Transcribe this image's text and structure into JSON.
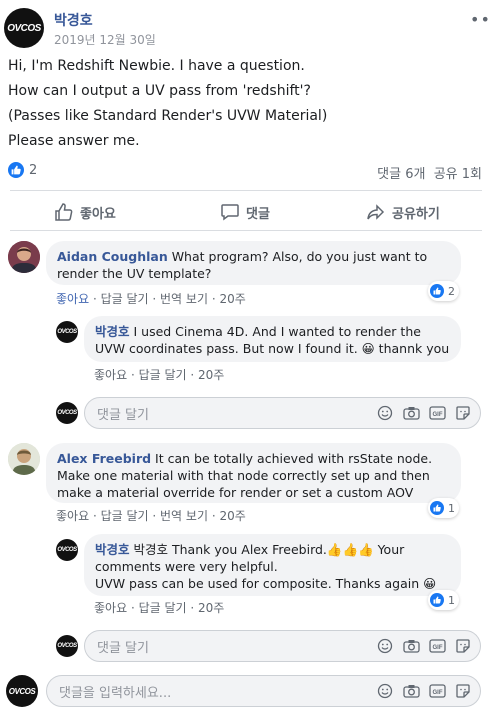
{
  "post": {
    "author": "박경호",
    "date": "2019년 12월 30일",
    "lines": [
      "Hi, I'm Redshift Newbie. I have a question.",
      "How can I output a UV pass from 'redshift'?",
      "(Passes like Standard Render's UVW Material)",
      "Please answer me."
    ],
    "reaction_count": "2",
    "stats": "댓글 6개  공유 1회",
    "more_icon": "ellipsis-icon",
    "avatar_text": "OVCOS"
  },
  "actions": {
    "like": "좋아요",
    "comment": "댓글",
    "share": "공유하기"
  },
  "comments": [
    {
      "author": "Aidan Coughlan",
      "text": " What program? Also, do you just want to render the UV template?",
      "like": "좋아요",
      "reply": "답글 달기",
      "translate": "번역 보기",
      "time": "20주",
      "reactions": "2"
    },
    {
      "author": "박경호",
      "text": " I used Cinema 4D. And I wanted to render the UVW coordinates pass. But now I found it. 😀 thannk you",
      "like": "좋아요",
      "reply": "답글 달기",
      "time": "20주"
    },
    {
      "author": "Alex Freebird",
      "text": " It can be totally achieved with rsState node. Make one material with that node correctly set up and then make a material override for render or set a custom AOV",
      "like": "좋아요",
      "reply": "답글 달기",
      "translate": "번역 보기",
      "time": "20주",
      "reactions": "1"
    },
    {
      "author": "박경호",
      "mention": "박경호",
      "text": " Thank you Alex Freebird.👍👍👍 Your comments were very helpful.",
      "text2": "UVW pass can be used for composite. Thanks again 😀",
      "like": "좋아요",
      "reply": "답글 달기",
      "time": "20주",
      "reactions": "1"
    }
  ],
  "reply_placeholder": "댓글 달기",
  "main_placeholder": "댓글을 입력하세요...",
  "colors": {
    "link": "#385898",
    "accent": "#1877f2",
    "bubble": "#f2f3f5"
  }
}
